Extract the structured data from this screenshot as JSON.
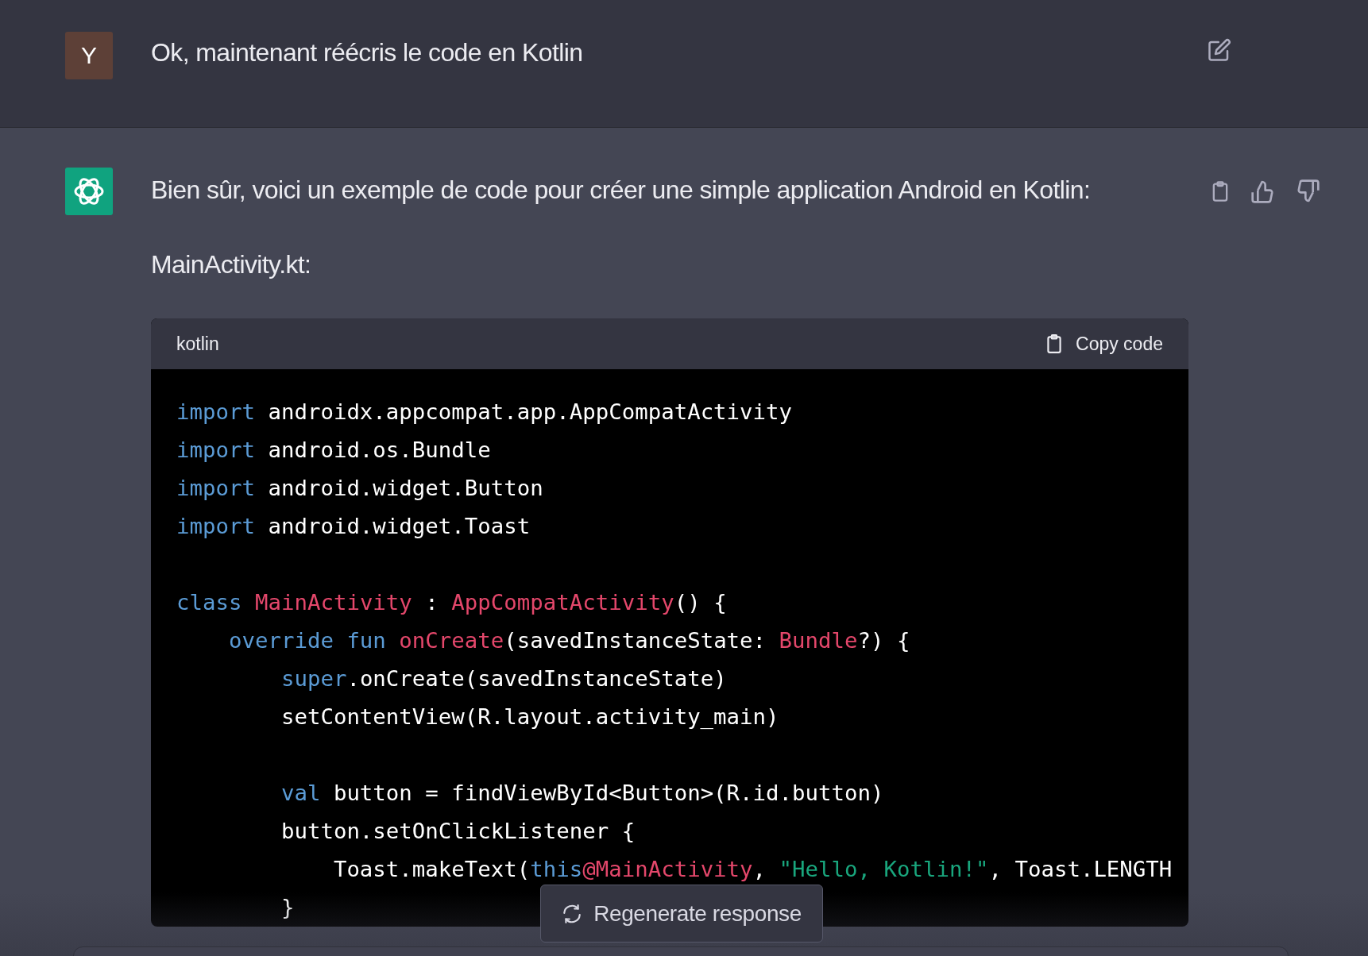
{
  "user_message": {
    "avatar": "Y",
    "text": "Ok, maintenant réécris le code en Kotlin"
  },
  "assistant_message": {
    "intro": "Bien sûr, voici un exemple de code pour créer une simple application Android en Kotlin:",
    "filename": "MainActivity.kt:",
    "code_block": {
      "language": "kotlin",
      "copy_label": "Copy code",
      "lines": [
        {
          "kind": "code",
          "tokens": [
            {
              "kind": "kw",
              "s": "import "
            },
            {
              "kind": "plain",
              "s": "androidx.appcompat.app.AppCompatActivity"
            }
          ]
        },
        {
          "kind": "code",
          "tokens": [
            {
              "kind": "kw",
              "s": "import "
            },
            {
              "kind": "plain",
              "s": "android.os.Bundle"
            }
          ]
        },
        {
          "kind": "code",
          "tokens": [
            {
              "kind": "kw",
              "s": "import "
            },
            {
              "kind": "plain",
              "s": "android.widget.Button"
            }
          ]
        },
        {
          "kind": "code",
          "tokens": [
            {
              "kind": "kw",
              "s": "import "
            },
            {
              "kind": "plain",
              "s": "android.widget.Toast"
            }
          ]
        },
        {
          "kind": "blank"
        },
        {
          "kind": "code",
          "tokens": [
            {
              "kind": "kw",
              "s": "class "
            },
            {
              "kind": "type",
              "s": "MainActivity"
            },
            {
              "kind": "plain",
              "s": " : "
            },
            {
              "kind": "type",
              "s": "AppCompatActivity"
            },
            {
              "kind": "plain",
              "s": "() {"
            }
          ]
        },
        {
          "kind": "code",
          "tokens": [
            {
              "kind": "kw",
              "s": "    override fun "
            },
            {
              "kind": "type",
              "s": "onCreate"
            },
            {
              "kind": "plain",
              "s": "(savedInstanceState: "
            },
            {
              "kind": "type",
              "s": "Bundle"
            },
            {
              "kind": "plain",
              "s": "?) {"
            }
          ]
        },
        {
          "kind": "code",
          "tokens": [
            {
              "kind": "kw",
              "s": "        super"
            },
            {
              "kind": "plain",
              "s": ".onCreate(savedInstanceState)"
            }
          ]
        },
        {
          "kind": "code",
          "tokens": [
            {
              "kind": "plain",
              "s": "        setContentView(R.layout.activity_main)"
            }
          ]
        },
        {
          "kind": "blank"
        },
        {
          "kind": "code",
          "tokens": [
            {
              "kind": "kw",
              "s": "        val "
            },
            {
              "kind": "plain",
              "s": "button = findViewById<Button>(R.id.button)"
            }
          ]
        },
        {
          "kind": "code",
          "tokens": [
            {
              "kind": "plain",
              "s": "        button.setOnClickListener {"
            }
          ]
        },
        {
          "kind": "code",
          "tokens": [
            {
              "kind": "plain",
              "s": "            Toast.makeText("
            },
            {
              "kind": "kw",
              "s": "this"
            },
            {
              "kind": "type",
              "s": "@MainActivity"
            },
            {
              "kind": "plain",
              "s": ", "
            },
            {
              "kind": "str",
              "s": "\"Hello, Kotlin!\""
            },
            {
              "kind": "plain",
              "s": ", Toast.LENGTH"
            }
          ]
        },
        {
          "kind": "code",
          "tokens": [
            {
              "kind": "plain",
              "s": "        }"
            }
          ]
        }
      ]
    }
  },
  "regenerate_button": {
    "label": "Regenerate response"
  }
}
